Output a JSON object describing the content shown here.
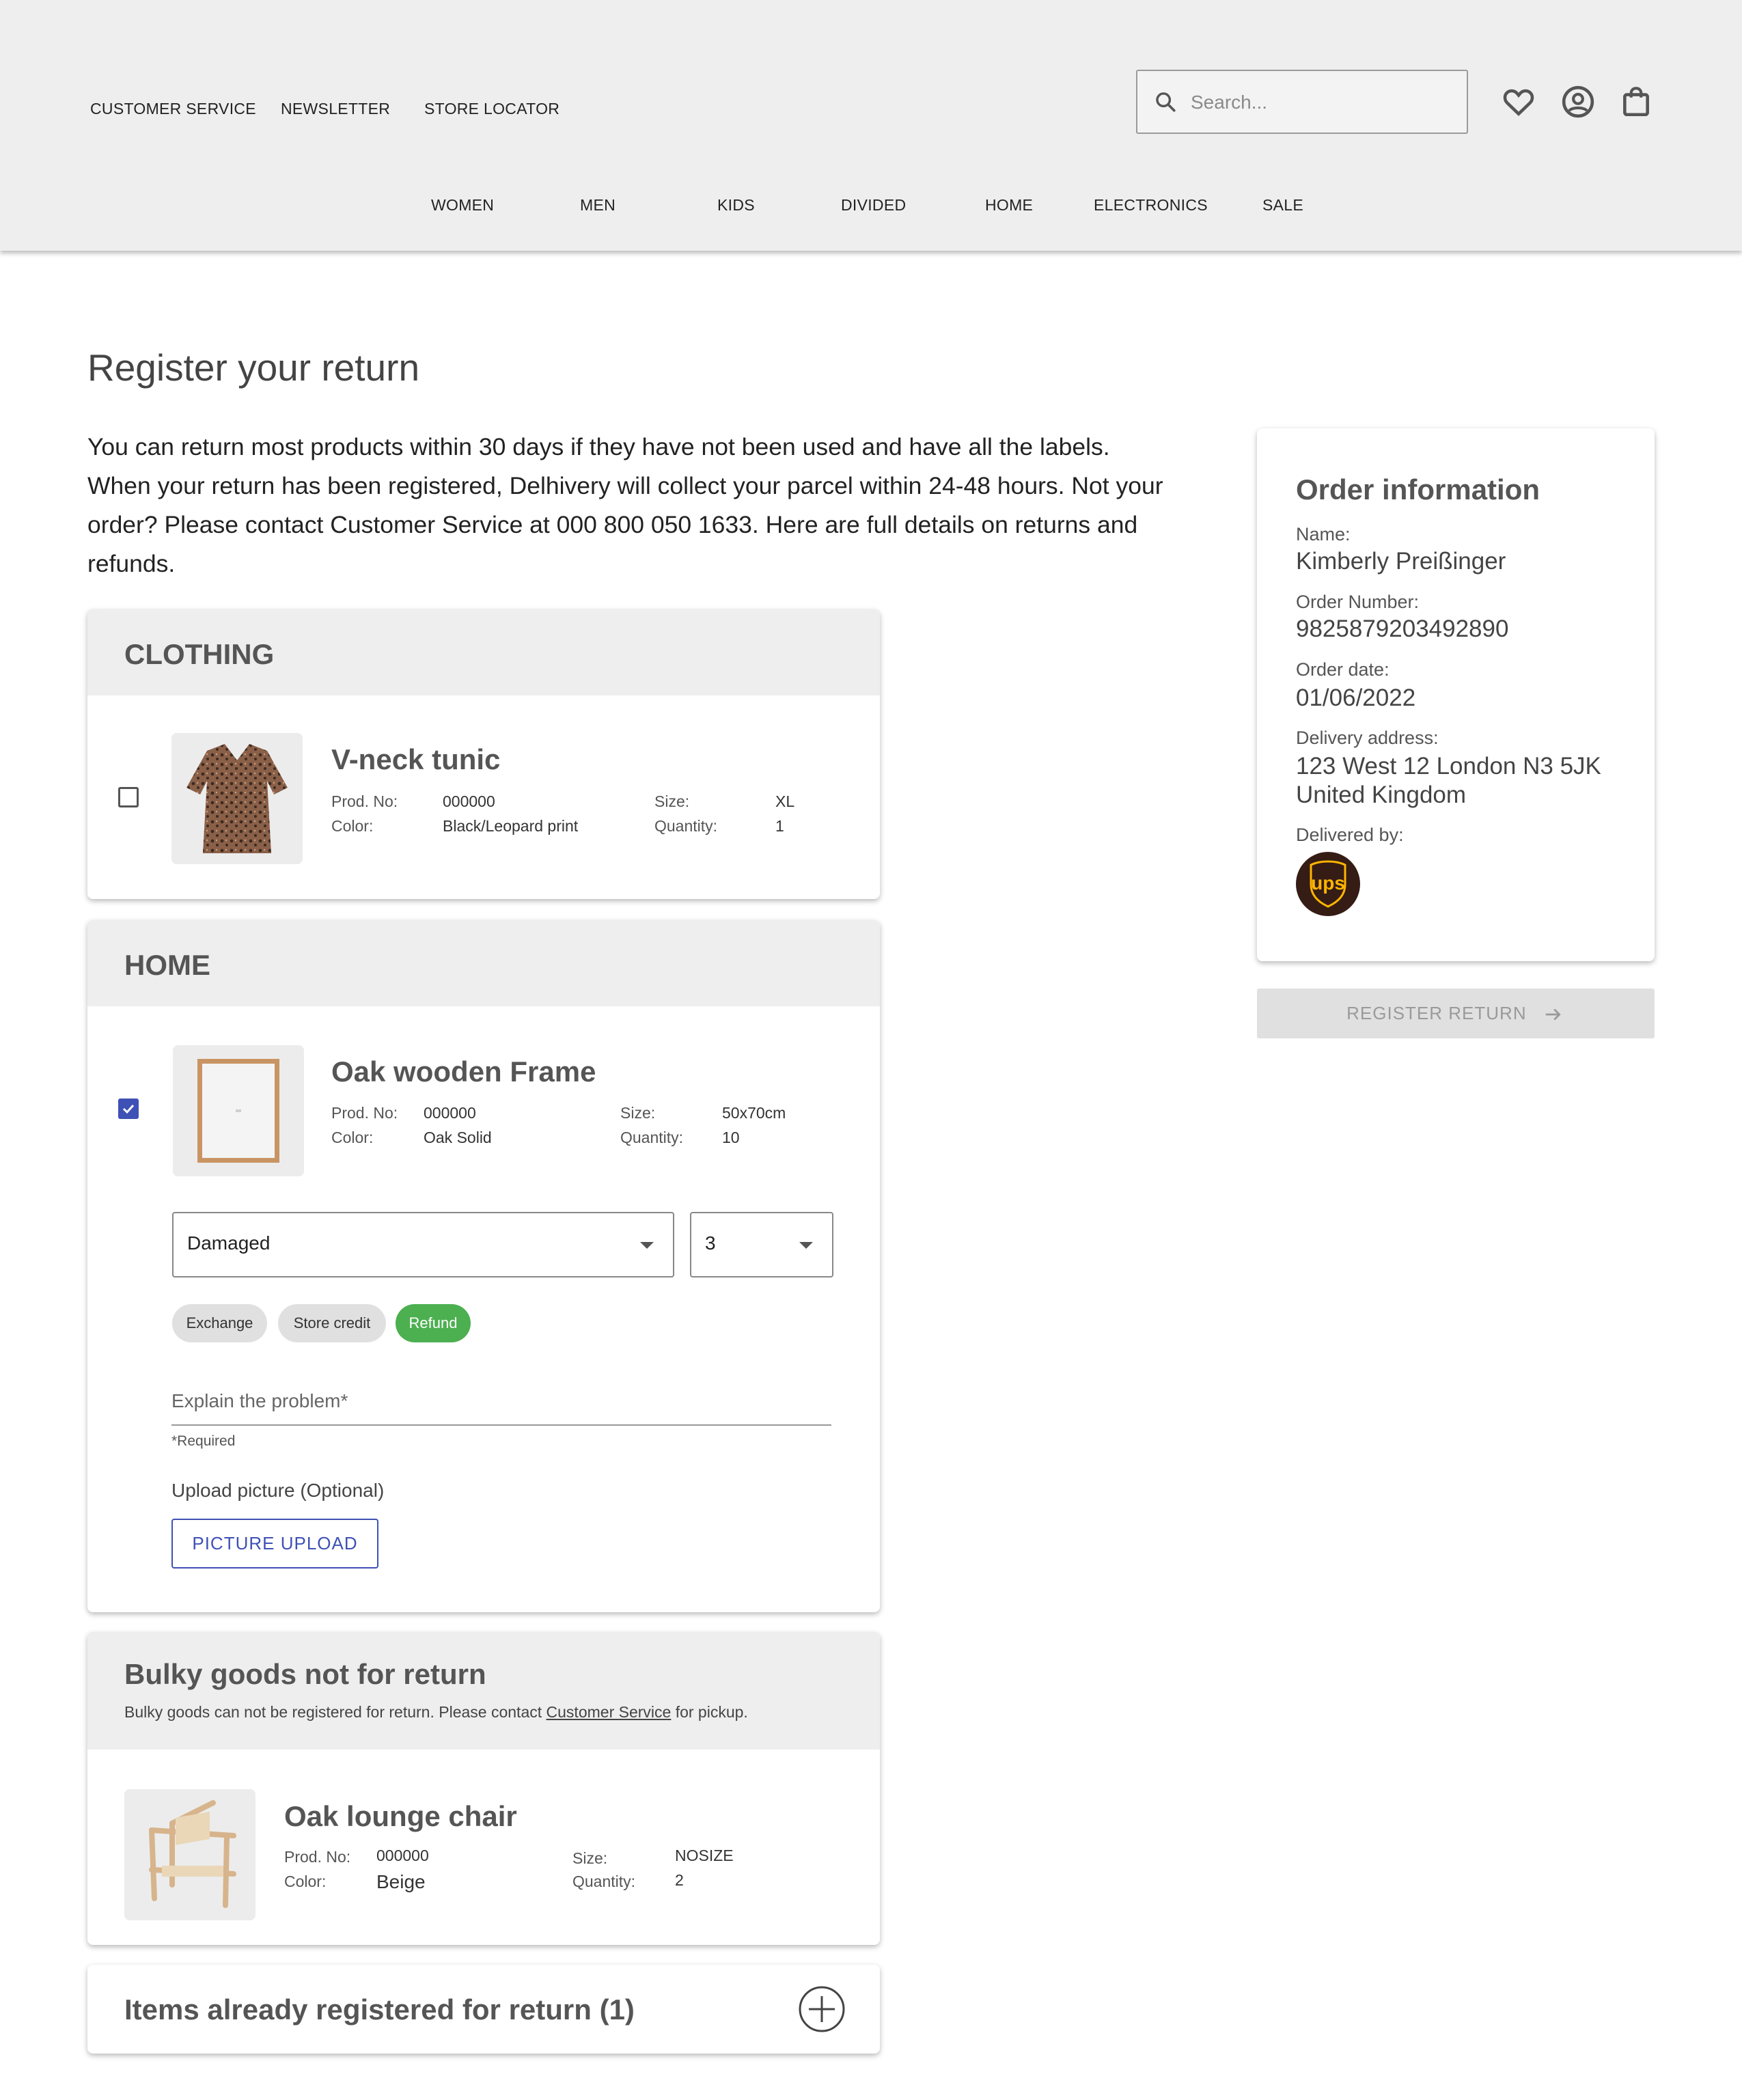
{
  "header": {
    "top_links": [
      "CUSTOMER SERVICE",
      "NEWSLETTER",
      "STORE LOCATOR"
    ],
    "search_placeholder": "Search...",
    "icons": [
      "search-icon",
      "heart-icon",
      "account-icon",
      "bag-icon"
    ],
    "nav": [
      "WOMEN",
      "MEN",
      "KIDS",
      "DIVIDED",
      "HOME",
      "ELECTRONICS",
      "SALE"
    ]
  },
  "page": {
    "title": "Register your return",
    "intro": "You can return most products within 30 days if they have not been used and have all the labels. When your return has been registered, Delhivery will collect your parcel within 24-48 hours. Not your order? Please contact Customer Service at 000 800 050 1633. Here are full details on returns and refunds."
  },
  "clothing": {
    "heading": "CLOTHING",
    "item": {
      "checked": false,
      "name": "V-neck tunic",
      "prod_label": "Prod. No:",
      "prod_no": "000000",
      "color_label": "Color:",
      "color": "Black/Leopard print",
      "size_label": "Size:",
      "size": "XL",
      "qty_label": "Quantity:",
      "qty": "1"
    }
  },
  "home": {
    "heading": "HOME",
    "item": {
      "checked": true,
      "name": "Oak wooden Frame",
      "prod_label": "Prod. No:",
      "prod_no": "000000",
      "color_label": "Color:",
      "color": "Oak Solid",
      "size_label": "Size:",
      "size": "50x70cm",
      "qty_label": "Quantity:",
      "qty": "10"
    },
    "reason_value": "Damaged",
    "qty_value": "3",
    "chips": [
      "Exchange",
      "Store credit",
      "Refund"
    ],
    "selected_chip": "Refund",
    "explain_placeholder": "Explain the problem*",
    "required_note": "*Required",
    "upload_label": "Upload picture (Optional)",
    "upload_button": "PICTURE UPLOAD"
  },
  "bulky": {
    "heading": "Bulky goods not for return",
    "note_before": "Bulky goods can not be registered for return. Please contact ",
    "note_link": "Customer Service",
    "note_after": " for pickup.",
    "item": {
      "name": "Oak lounge chair",
      "prod_label": "Prod. No:",
      "prod_no": "000000",
      "color_label": "Color:",
      "color": "Beige",
      "size_label": "Size:",
      "size": "NOSIZE",
      "qty_label": "Quantity:",
      "qty": "2"
    }
  },
  "registered": {
    "heading": "Items already registered for return (1)"
  },
  "order": {
    "title": "Order information",
    "name_label": "Name:",
    "name": "Kimberly Preißinger",
    "number_label": "Order Number:",
    "number": "9825879203492890",
    "date_label": "Order date:",
    "date": "01/06/2022",
    "address_label": "Delivery address:",
    "address": "123 West 12 London N3 5JK United Kingdom",
    "delivered_label": "Delivered by:",
    "carrier_logo_text": "ups"
  },
  "register_button": "REGISTER RETURN",
  "colors": {
    "header_bg": "#efeeef",
    "accent_blue": "#3f51b5",
    "refund_green": "#4caf50",
    "chip_grey": "#e0e0e0",
    "ups_brown": "#351c15",
    "ups_gold": "#ffb500"
  }
}
